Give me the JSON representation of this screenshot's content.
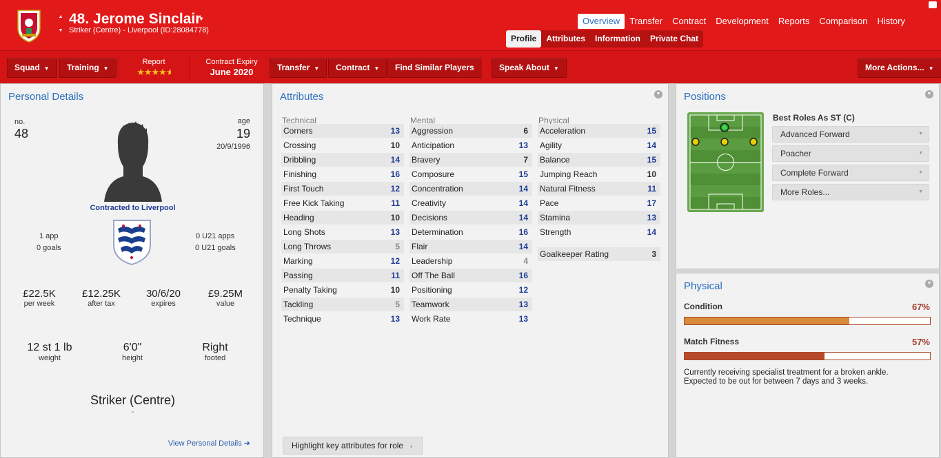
{
  "header": {
    "player_name": "48. Jerome Sinclair",
    "player_sub": "Striker (Centre) - Liverpool (ID:28084778)",
    "club_badge": "liverpool-crest",
    "brand_color": "#e21919"
  },
  "nav_tabs": [
    "Overview",
    "Transfer",
    "Contract",
    "Development",
    "Reports",
    "Comparison",
    "History"
  ],
  "sub_tabs": [
    "Profile",
    "Attributes",
    "Information",
    "Private Chat"
  ],
  "toolbar": {
    "squad": "Squad",
    "training": "Training",
    "report_label": "Report",
    "report_stars": "★★★★",
    "report_star_half": "★",
    "report_stars_value": 4.5,
    "contract_label": "Contract Expiry",
    "contract_value": "June 2020",
    "transfer": "Transfer",
    "contract": "Contract",
    "find_similar": "Find Similar Players",
    "speak_about": "Speak About",
    "more_actions": "More Actions..."
  },
  "personal": {
    "title": "Personal Details",
    "no_label": "no.",
    "no_value": "48",
    "age_label": "age",
    "age_value": "19",
    "dob": "20/9/1996",
    "contracted": "Contracted to Liverpool",
    "apps": "1 app",
    "goals": "0 goals",
    "u21_apps": "0 U21 apps",
    "u21_goals": "0 U21 goals",
    "nation_badge": "england-crest",
    "wage": "£22.5K",
    "wage_label": "per week",
    "after_tax": "£12.25K",
    "after_tax_label": "after tax",
    "expires": "30/6/20",
    "expires_label": "expires",
    "value": "£9.25M",
    "value_label": "value",
    "weight": "12 st 1 lb",
    "weight_label": "weight",
    "height": "6'0\"",
    "height_label": "height",
    "foot": "Right",
    "foot_label": "footed",
    "position": "Striker (Centre)",
    "position_sub": "-",
    "view_link": "View Personal Details ➜"
  },
  "attributes": {
    "title": "Attributes",
    "technical_label": "Technical",
    "mental_label": "Mental",
    "physical_label": "Physical",
    "technical": [
      {
        "name": "Corners",
        "value": "13"
      },
      {
        "name": "Crossing",
        "value": "10"
      },
      {
        "name": "Dribbling",
        "value": "14"
      },
      {
        "name": "Finishing",
        "value": "16"
      },
      {
        "name": "First Touch",
        "value": "12"
      },
      {
        "name": "Free Kick Taking",
        "value": "11"
      },
      {
        "name": "Heading",
        "value": "10"
      },
      {
        "name": "Long Shots",
        "value": "13"
      },
      {
        "name": "Long Throws",
        "value": "5"
      },
      {
        "name": "Marking",
        "value": "12"
      },
      {
        "name": "Passing",
        "value": "11"
      },
      {
        "name": "Penalty Taking",
        "value": "10"
      },
      {
        "name": "Tackling",
        "value": "5"
      },
      {
        "name": "Technique",
        "value": "13"
      }
    ],
    "mental": [
      {
        "name": "Aggression",
        "value": "6"
      },
      {
        "name": "Anticipation",
        "value": "13"
      },
      {
        "name": "Bravery",
        "value": "7"
      },
      {
        "name": "Composure",
        "value": "15"
      },
      {
        "name": "Concentration",
        "value": "14"
      },
      {
        "name": "Creativity",
        "value": "14"
      },
      {
        "name": "Decisions",
        "value": "14"
      },
      {
        "name": "Determination",
        "value": "16"
      },
      {
        "name": "Flair",
        "value": "14"
      },
      {
        "name": "Leadership",
        "value": "4"
      },
      {
        "name": "Off The Ball",
        "value": "16"
      },
      {
        "name": "Positioning",
        "value": "12"
      },
      {
        "name": "Teamwork",
        "value": "13"
      },
      {
        "name": "Work Rate",
        "value": "13"
      }
    ],
    "physical": [
      {
        "name": "Acceleration",
        "value": "15"
      },
      {
        "name": "Agility",
        "value": "14"
      },
      {
        "name": "Balance",
        "value": "15"
      },
      {
        "name": "Jumping Reach",
        "value": "10"
      },
      {
        "name": "Natural Fitness",
        "value": "11"
      },
      {
        "name": "Pace",
        "value": "17"
      },
      {
        "name": "Stamina",
        "value": "13"
      },
      {
        "name": "Strength",
        "value": "14"
      }
    ],
    "gk_label": "Goalkeeper Rating",
    "gk_value": "3",
    "highlight_button": "Highlight key attributes for role"
  },
  "positions": {
    "title": "Positions",
    "best_roles_label": "Best Roles As ST (C)",
    "roles": [
      "Advanced Forward",
      "Poacher",
      "Complete Forward",
      "More Roles..."
    ]
  },
  "physical": {
    "title": "Physical",
    "condition_label": "Condition",
    "condition_value": "67%",
    "condition_fraction": 0.67,
    "condition_color": "#d98b3a",
    "fitness_label": "Match Fitness",
    "fitness_value": "57%",
    "fitness_fraction": 0.57,
    "fitness_color": "#b84a2a",
    "injury_line1": "Currently receiving specialist treatment for a broken ankle.",
    "injury_line2": "Expected to be out for between 7 days and 3 weeks."
  }
}
